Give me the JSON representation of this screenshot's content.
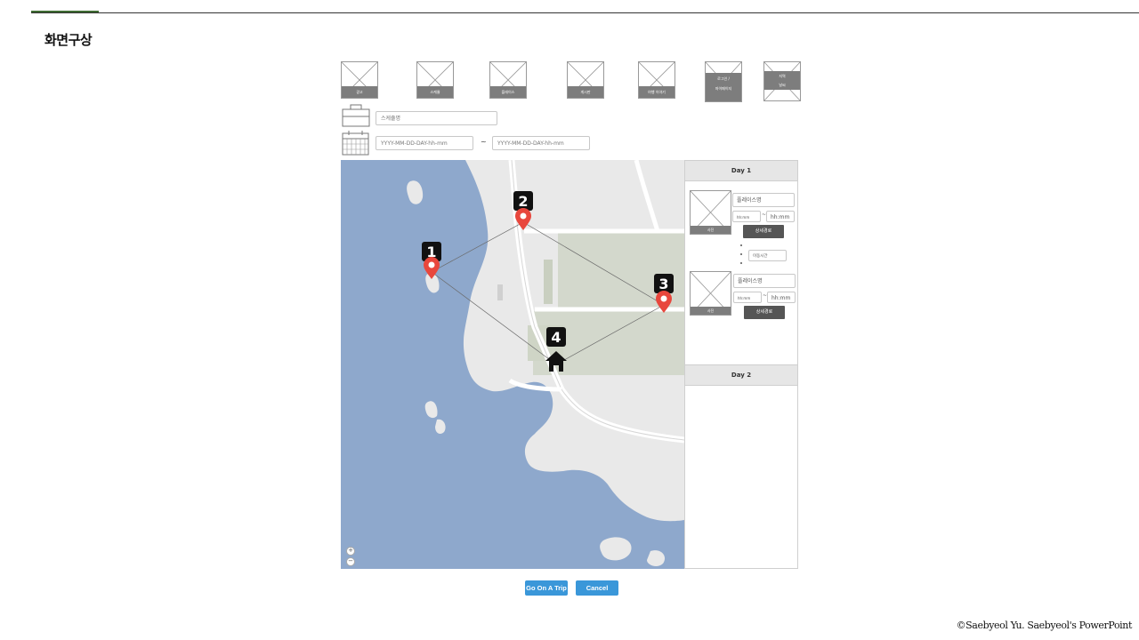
{
  "slide": {
    "title": "화면구상",
    "credit": "©Saebyeol Yu. Saebyeol's PowerPoint"
  },
  "nav": {
    "tiles": [
      {
        "label": "광고"
      },
      {
        "label": "스케쥴"
      },
      {
        "label": "플레이스"
      },
      {
        "label": "게시판"
      },
      {
        "label": "여행 이야기"
      },
      {
        "label_top": "로그인 /",
        "label_bottom": "마이페이지"
      },
      {
        "label_top": "지역",
        "label_bottom": "날씨"
      }
    ]
  },
  "schedule": {
    "name_placeholder": "스케쥴명",
    "start_placeholder": "YYYY-MM-DD-DAY-hh-mm",
    "end_placeholder": "YYYY-MM-DD-DAY-hh-mm",
    "range_separator": "~"
  },
  "map": {
    "markers": [
      {
        "number": "1",
        "kind": "pin"
      },
      {
        "number": "2",
        "kind": "pin"
      },
      {
        "number": "3",
        "kind": "pin"
      },
      {
        "number": "4",
        "kind": "home"
      }
    ],
    "zoom_in": "+",
    "zoom_out": "−"
  },
  "itinerary": {
    "days": [
      {
        "label": "Day 1",
        "places": [
          {
            "photo_label": "사진",
            "name_placeholder": "플레이스명",
            "time_start": "hh:mm",
            "time_end": "hh:mm",
            "time_sep": "~",
            "route_button": "상세경로"
          },
          {
            "photo_label": "사진",
            "name_placeholder": "플레이스명",
            "time_start": "hh:mm",
            "time_end": "hh:mm",
            "time_sep": "~",
            "route_button": "상세경로"
          }
        ],
        "travel_time_placeholder": "이동시간"
      },
      {
        "label": "Day 2",
        "places": []
      }
    ]
  },
  "actions": {
    "go_label": "Go On A Trip",
    "cancel_label": "Cancel",
    "button_color": "#3a97d9"
  },
  "colors": {
    "accent": "#3f6b32",
    "water": "#8ea8cc",
    "land": "#e9e9e9",
    "marker": "#e8473d"
  }
}
